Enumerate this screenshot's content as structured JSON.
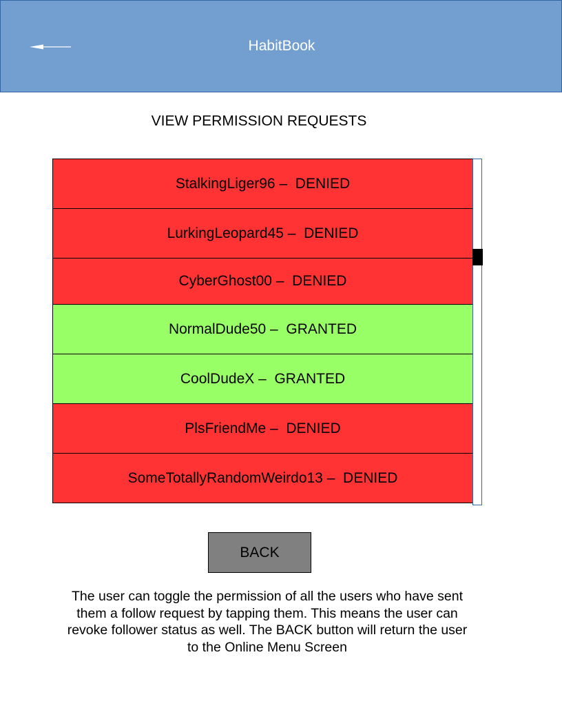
{
  "header": {
    "title": "HabitBook",
    "back_icon": "arrow-left-icon",
    "background_color": "#729fcf"
  },
  "page_title": "VIEW PERMISSION REQUESTS",
  "requests": [
    {
      "text": "StalkingLiger96 –  DENIED",
      "username": "StalkingLiger96",
      "status": "DENIED",
      "color": "#ff3333"
    },
    {
      "text": "LurkingLeopard45 –  DENIED",
      "username": "LurkingLeopard45",
      "status": "DENIED",
      "color": "#ff3333"
    },
    {
      "text": "CyberGhost00 –  DENIED",
      "username": "CyberGhost00",
      "status": "DENIED",
      "color": "#ff3333"
    },
    {
      "text": "NormalDude50 –  GRANTED",
      "username": "NormalDude50",
      "status": "GRANTED",
      "color": "#99ff66"
    },
    {
      "text": "CoolDudeX –  GRANTED",
      "username": "CoolDudeX",
      "status": "GRANTED",
      "color": "#99ff66"
    },
    {
      "text": "PlsFriendMe –  DENIED",
      "username": "PlsFriendMe",
      "status": "DENIED",
      "color": "#ff3333"
    },
    {
      "text": "SomeTotallyRandomWeirdo13 –  DENIED",
      "username": "SomeTotallyRandomWeirdo13",
      "status": "DENIED",
      "color": "#ff3333"
    }
  ],
  "back_button": {
    "label": "BACK",
    "color": "#808080"
  },
  "description": "The user can toggle the permission of all the users who have sent them a follow request by tapping them. This means the user can revoke follower status as well. The BACK button will return the user to the Online Menu Screen"
}
